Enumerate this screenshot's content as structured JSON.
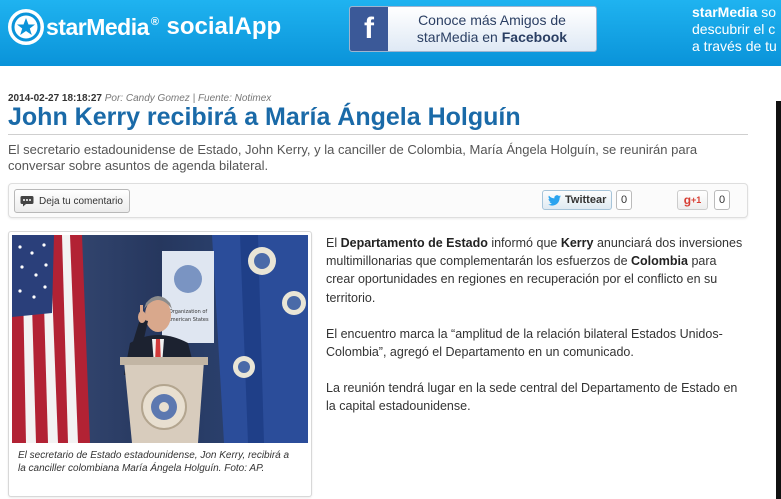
{
  "header": {
    "logo_text": "starMedia",
    "logo_mark": "®",
    "app_name": "socialApp",
    "fb_banner": {
      "line1": "Conoce más Amigos de",
      "line2_prefix": "starMedia en ",
      "line2_bold": "Facebook",
      "fb_letter": "f"
    },
    "promo": {
      "line1_bold": "starMedia",
      "line1_rest": " so",
      "line2": "descubrir el c",
      "line3": "a través de tu"
    }
  },
  "article": {
    "timestamp": "2014-02-27 18:18:27",
    "byline": "Por: Candy Gomez | Fuente: Notimex",
    "title": "John Kerry recibirá a María Ángela Holguín",
    "lead": "El secretario estadounidense de Estado, John Kerry, y la canciller de Colombia, María Ángela Holguín, se reunirán para conversar sobre asuntos de agenda bilateral."
  },
  "toolbar": {
    "comment_label": "Deja tu comentario",
    "twitter_label": "Twittear",
    "twitter_count": "0",
    "gplus_label": "g",
    "gplus_suffix": "+1",
    "gplus_count": "0"
  },
  "figure": {
    "caption": "El secretario de Estado estadounidense, Jon Kerry, recibirá a la canciller colombiana María Ángela Holguín. Foto: AP.",
    "podium_sign_top": "Organization of American States"
  },
  "body": {
    "p1": {
      "t1": "El ",
      "b1": "Departamento de Estado",
      "t2": " informó que ",
      "b2": "Kerry",
      "t3": " anunciará dos inversiones multimillonarias que complementarán los esfuerzos de ",
      "b3": "Colombia",
      "t4": " para crear oportunidades en regiones en recuperación por el conflicto en su territorio."
    },
    "p2": "El encuentro marca la “amplitud de la relación bilateral Estados Unidos-Colombia”, agregó el Departamento en un comunicado.",
    "p3": "La reunión tendrá lugar en la sede central del Departamento de Estado en la capital estadounidense."
  },
  "colors": {
    "header_blue": "#0a93d9",
    "title_blue": "#1a6aa8",
    "facebook": "#3b5998",
    "gplus": "#d73d32"
  }
}
